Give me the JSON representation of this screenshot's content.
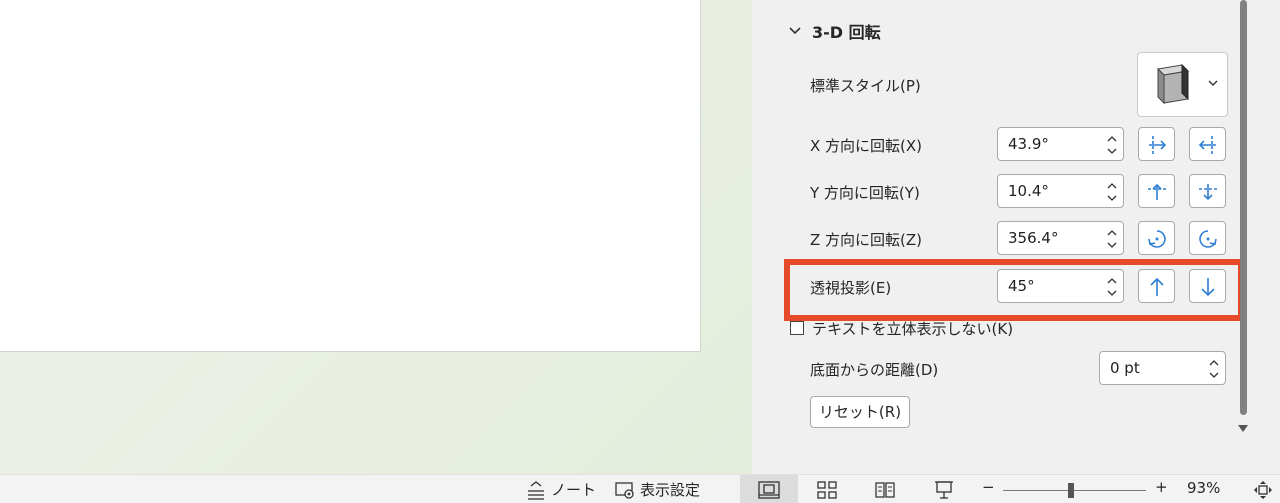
{
  "section": {
    "title": "3-D 回転"
  },
  "preset": {
    "label": "標準スタイル(P)"
  },
  "rows": {
    "x": {
      "label": "X 方向に回転(X)",
      "value": "43.9°"
    },
    "y": {
      "label": "Y 方向に回転(Y)",
      "value": "10.4°"
    },
    "z": {
      "label": "Z 方向に回転(Z)",
      "value": "356.4°"
    },
    "perspective": {
      "label": "透視投影(E)",
      "value": "45°"
    }
  },
  "keep_text_flat": {
    "label": "テキストを立体表示しない(K)"
  },
  "distance": {
    "label": "底面からの距離(D)",
    "value": "0 pt"
  },
  "reset": {
    "label": "リセット(R)"
  },
  "statusbar": {
    "notes": "ノート",
    "display_settings": "表示設定",
    "zoom_minus": "−",
    "zoom_plus": "+",
    "zoom_level": "93%"
  },
  "colors": {
    "highlight": "#e54a2a",
    "icon_blue": "#2f7fd4"
  }
}
